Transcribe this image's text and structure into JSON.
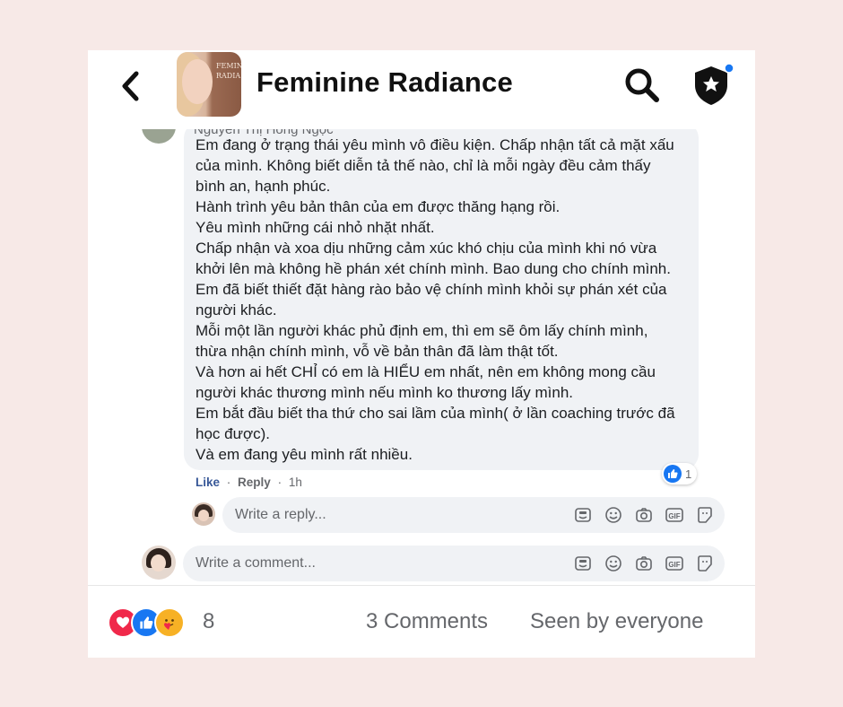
{
  "header": {
    "title": "Feminine Radiance",
    "avatar_text": "FEMIN RADIA",
    "back_icon": "chevron-left-icon",
    "search_icon": "search-icon",
    "shield_icon": "shield-star-icon",
    "notification_dot_color": "#1877f2"
  },
  "comment": {
    "author_cut": "Nguyễn Thị Hồng Ngọc",
    "lines": [
      "Em đang ở trạng thái yêu mình vô điều kiện. Chấp nhận tất cả mặt xấu",
      "của mình. Không biết diễn tả thế nào, chỉ là mỗi ngày đều cảm thấy",
      "bình an, hạnh phúc.",
      "Hành trình yêu bản thân của em được thăng hạng rồi.",
      "Yêu mình những cái nhỏ nhặt nhất.",
      "Chấp nhận và xoa dịu những cảm xúc khó chịu của mình khi nó vừa",
      "khởi lên mà không hề phán xét chính mình. Bao dung cho chính mình.",
      "Em đã biết thiết đặt hàng rào bảo vệ chính mình khỏi sự phán xét của",
      "người khác.",
      "Mỗi một lần người khác phủ định em, thì em sẽ ôm lấy chính mình,",
      "thừa nhận chính mình, vỗ về bản thân đã làm thật tốt.",
      "Và hơn ai hết CHỈ có em là HIỂU em nhất, nên em không mong cầu",
      "người khác thương mình nếu mình ko thương lấy mình.",
      "Em bắt đầu biết tha thứ cho sai lầm của mình( ở lần coaching trước đã",
      "học được).",
      "Và em đang yêu mình rất nhiều."
    ],
    "reaction_count": "1",
    "like_label": "Like",
    "reply_label": "Reply",
    "time": "1h",
    "separator": "·"
  },
  "reply_input": {
    "placeholder": "Write a reply..."
  },
  "comment_input": {
    "placeholder": "Write a comment..."
  },
  "toolbar_icons": [
    "sticker-icon",
    "emoji-icon",
    "camera-icon",
    "gif-icon",
    "avatar-sticker-icon"
  ],
  "footer": {
    "reactions": [
      "heart-icon",
      "like-icon",
      "care-icon"
    ],
    "reaction_total": "8",
    "comments": "3 Comments",
    "seen": "Seen by everyone"
  },
  "colors": {
    "background": "#f7e9e7",
    "bubble": "#f0f2f5",
    "accent": "#1877f2",
    "heart": "#f0284a",
    "care": "#f7b125"
  }
}
